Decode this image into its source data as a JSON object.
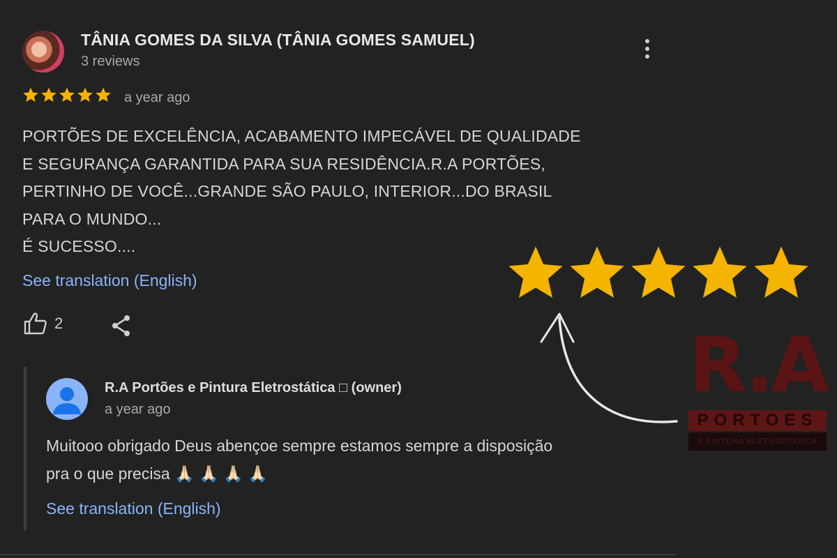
{
  "review": {
    "reviewer_name": "TÂNIA GOMES DA SILVA (TÂNIA GOMES SAMUEL)",
    "review_count": "3 reviews",
    "rating": 5,
    "date": "a year ago",
    "text": "PORTÕES DE EXCELÊNCIA, ACABAMENTO IMPECÁVEL DE QUALIDADE\nE SEGURANÇA GARANTIDA PARA SUA RESIDÊNCIA.R.A PORTÕES,\nPERTINHO DE VOCÊ...GRANDE SÃO PAULO, INTERIOR...DO BRASIL\nPARA O MUNDO...\nÉ SUCESSO....",
    "translate_label": "See translation (English)",
    "like_count": "2"
  },
  "owner_response": {
    "name": "R.A Portões e Pintura Eletrostática □  (owner)",
    "date": "a year ago",
    "text": "Muitooo obrigado Deus abençoe sempre estamos sempre a disposição\npra o que precisa 🙏🏻 🙏🏻 🙏🏻 🙏🏻",
    "translate_label": "See translation (English)"
  },
  "overlay": {
    "big_star_rating": 5,
    "logo_mark": "R.A",
    "logo_bar": "PORTOES",
    "logo_sub": "E PINTURA ELETROSTATICA"
  },
  "colors": {
    "background": "#222222",
    "star": "#f4b400",
    "link": "#8ab4f8",
    "logo_red": "#5a1414"
  },
  "icons": [
    "more-vert-icon",
    "star-icon",
    "thumbs-up-icon",
    "share-icon",
    "person-icon",
    "curved-arrow-icon"
  ]
}
